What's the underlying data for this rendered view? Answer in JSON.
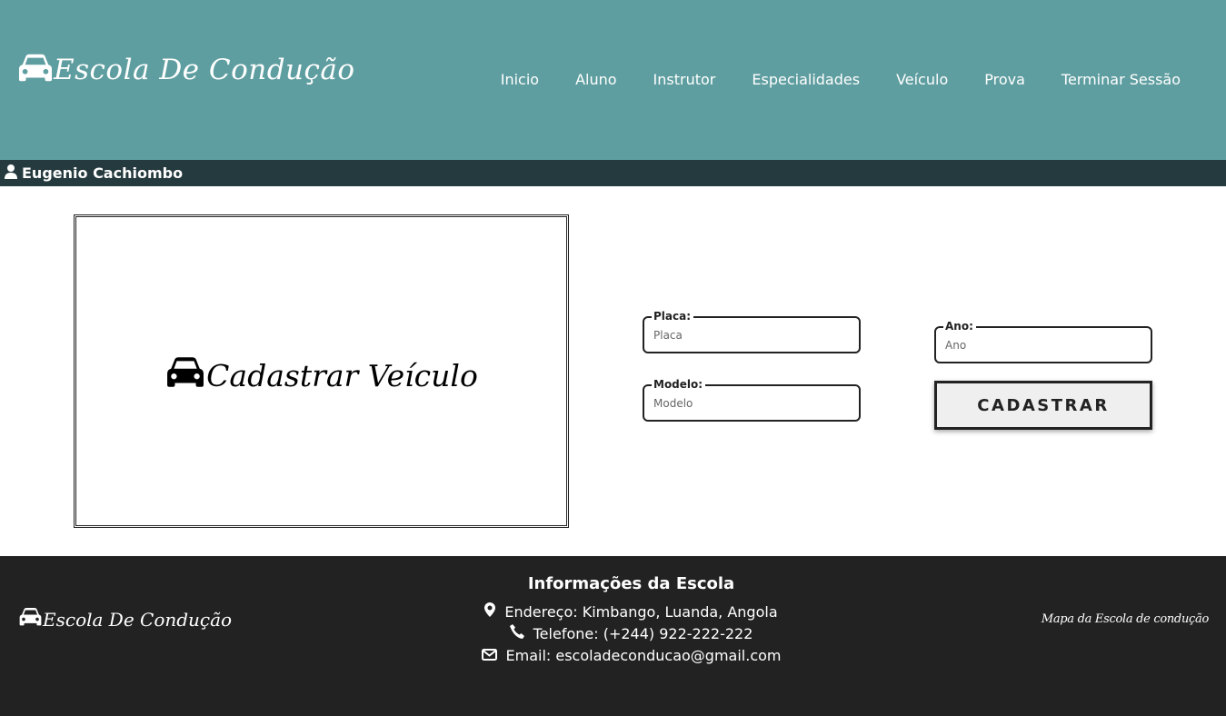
{
  "header": {
    "brand": "Escola De Condução",
    "nav": [
      "Inicio",
      "Aluno",
      "Instrutor",
      "Especialidades",
      "Veículo",
      "Prova",
      "Terminar Sessão"
    ]
  },
  "user": {
    "name": "Eugenio Cachiombo"
  },
  "panel": {
    "title": "Cadastrar Veículo"
  },
  "form": {
    "placa": {
      "label": "Placa:",
      "placeholder": "Placa",
      "value": ""
    },
    "modelo": {
      "label": "Modelo:",
      "placeholder": "Modelo",
      "value": ""
    },
    "ano": {
      "label": "Ano:",
      "placeholder": "Ano",
      "value": ""
    },
    "submit_label": "CADASTRAR"
  },
  "footer": {
    "brand": "Escola De Condução",
    "info_title": "Informações da Escola",
    "address": "Endereço: Kimbango, Luanda, Angola",
    "phone": "Telefone: (+244) 922-222-222",
    "email": "Email: escoladeconducao@gmail.com",
    "map_link": "Mapa da Escola de condução"
  },
  "colors": {
    "header_bg": "#5f9ea0",
    "userbar_bg": "#253a3e",
    "footer_bg": "#222222",
    "text_light": "#ffffff"
  },
  "icons": [
    "car-icon",
    "user-icon",
    "map-marker-icon",
    "phone-icon",
    "envelope-icon"
  ]
}
